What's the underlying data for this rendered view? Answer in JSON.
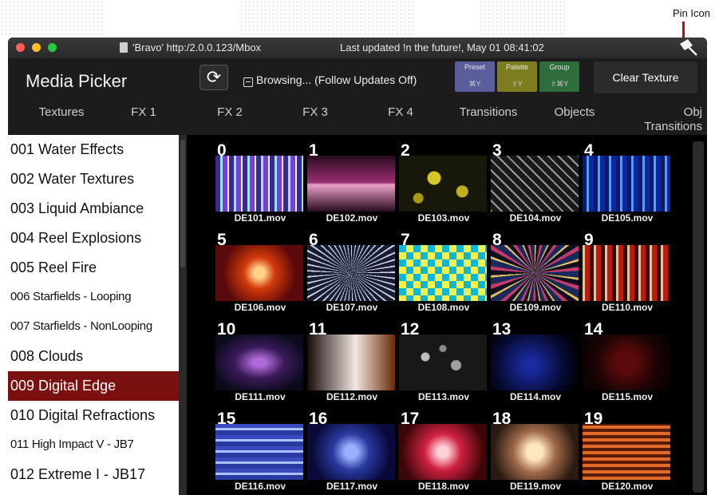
{
  "callout": {
    "pin_label": "Pin Icon"
  },
  "window": {
    "title": "'Bravo' http:/2.0.0.123/Mbox",
    "updated": "Last updated !n the future!, May 01 08:41:02",
    "pin_icon": "pin-icon"
  },
  "toolbar": {
    "app_title": "Media Picker",
    "refresh_glyph": "⟳",
    "browse_label": "Browsing... (Follow Updates Off)",
    "swatches": [
      {
        "name": "Preset",
        "shortcut": "⌘Y",
        "color": "#5a5f9c"
      },
      {
        "name": "Palette",
        "shortcut": "⇧Y",
        "color": "#7d7d20"
      },
      {
        "name": "Group",
        "shortcut": "⇧⌘Y",
        "color": "#2f6e3c"
      }
    ],
    "clear_label": "Clear Texture"
  },
  "tabs": [
    "Textures",
    "FX 1",
    "FX 2",
    "FX 3",
    "FX 4",
    "Transitions",
    "Objects",
    "Obj\nTransitions"
  ],
  "active_tab": "Textures",
  "sidebar": {
    "items": [
      "001 Water Effects",
      "002 Water Textures",
      "003 Liquid Ambiance",
      "004 Reel Explosions",
      "005 Reel Fire",
      "006 Starfields - Looping",
      "007 Starfields - NonLooping",
      "008 Clouds",
      "009 Digital Edge",
      "010 Digital Refractions",
      "011 High Impact V - JB7",
      "012 Extreme I - JB17"
    ],
    "selected_index": 8
  },
  "thumbnails": [
    {
      "num": "0",
      "file": "DE101.mov"
    },
    {
      "num": "1",
      "file": "DE102.mov"
    },
    {
      "num": "2",
      "file": "DE103.mov"
    },
    {
      "num": "3",
      "file": "DE104.mov"
    },
    {
      "num": "4",
      "file": "DE105.mov"
    },
    {
      "num": "5",
      "file": "DE106.mov"
    },
    {
      "num": "6",
      "file": "DE107.mov"
    },
    {
      "num": "7",
      "file": "DE108.mov"
    },
    {
      "num": "8",
      "file": "DE109.mov"
    },
    {
      "num": "9",
      "file": "DE110.mov"
    },
    {
      "num": "10",
      "file": "DE111.mov"
    },
    {
      "num": "11",
      "file": "DE112.mov"
    },
    {
      "num": "12",
      "file": "DE113.mov"
    },
    {
      "num": "13",
      "file": "DE114.mov"
    },
    {
      "num": "14",
      "file": "DE115.mov"
    },
    {
      "num": "15",
      "file": "DE116.mov"
    },
    {
      "num": "16",
      "file": "DE117.mov"
    },
    {
      "num": "17",
      "file": "DE118.mov"
    },
    {
      "num": "18",
      "file": "DE119.mov"
    },
    {
      "num": "19",
      "file": "DE120.mov"
    }
  ],
  "colors": {
    "selection": "#7a1010",
    "traffic_lights": [
      "#ff5f57",
      "#febc2e",
      "#28c840"
    ]
  }
}
